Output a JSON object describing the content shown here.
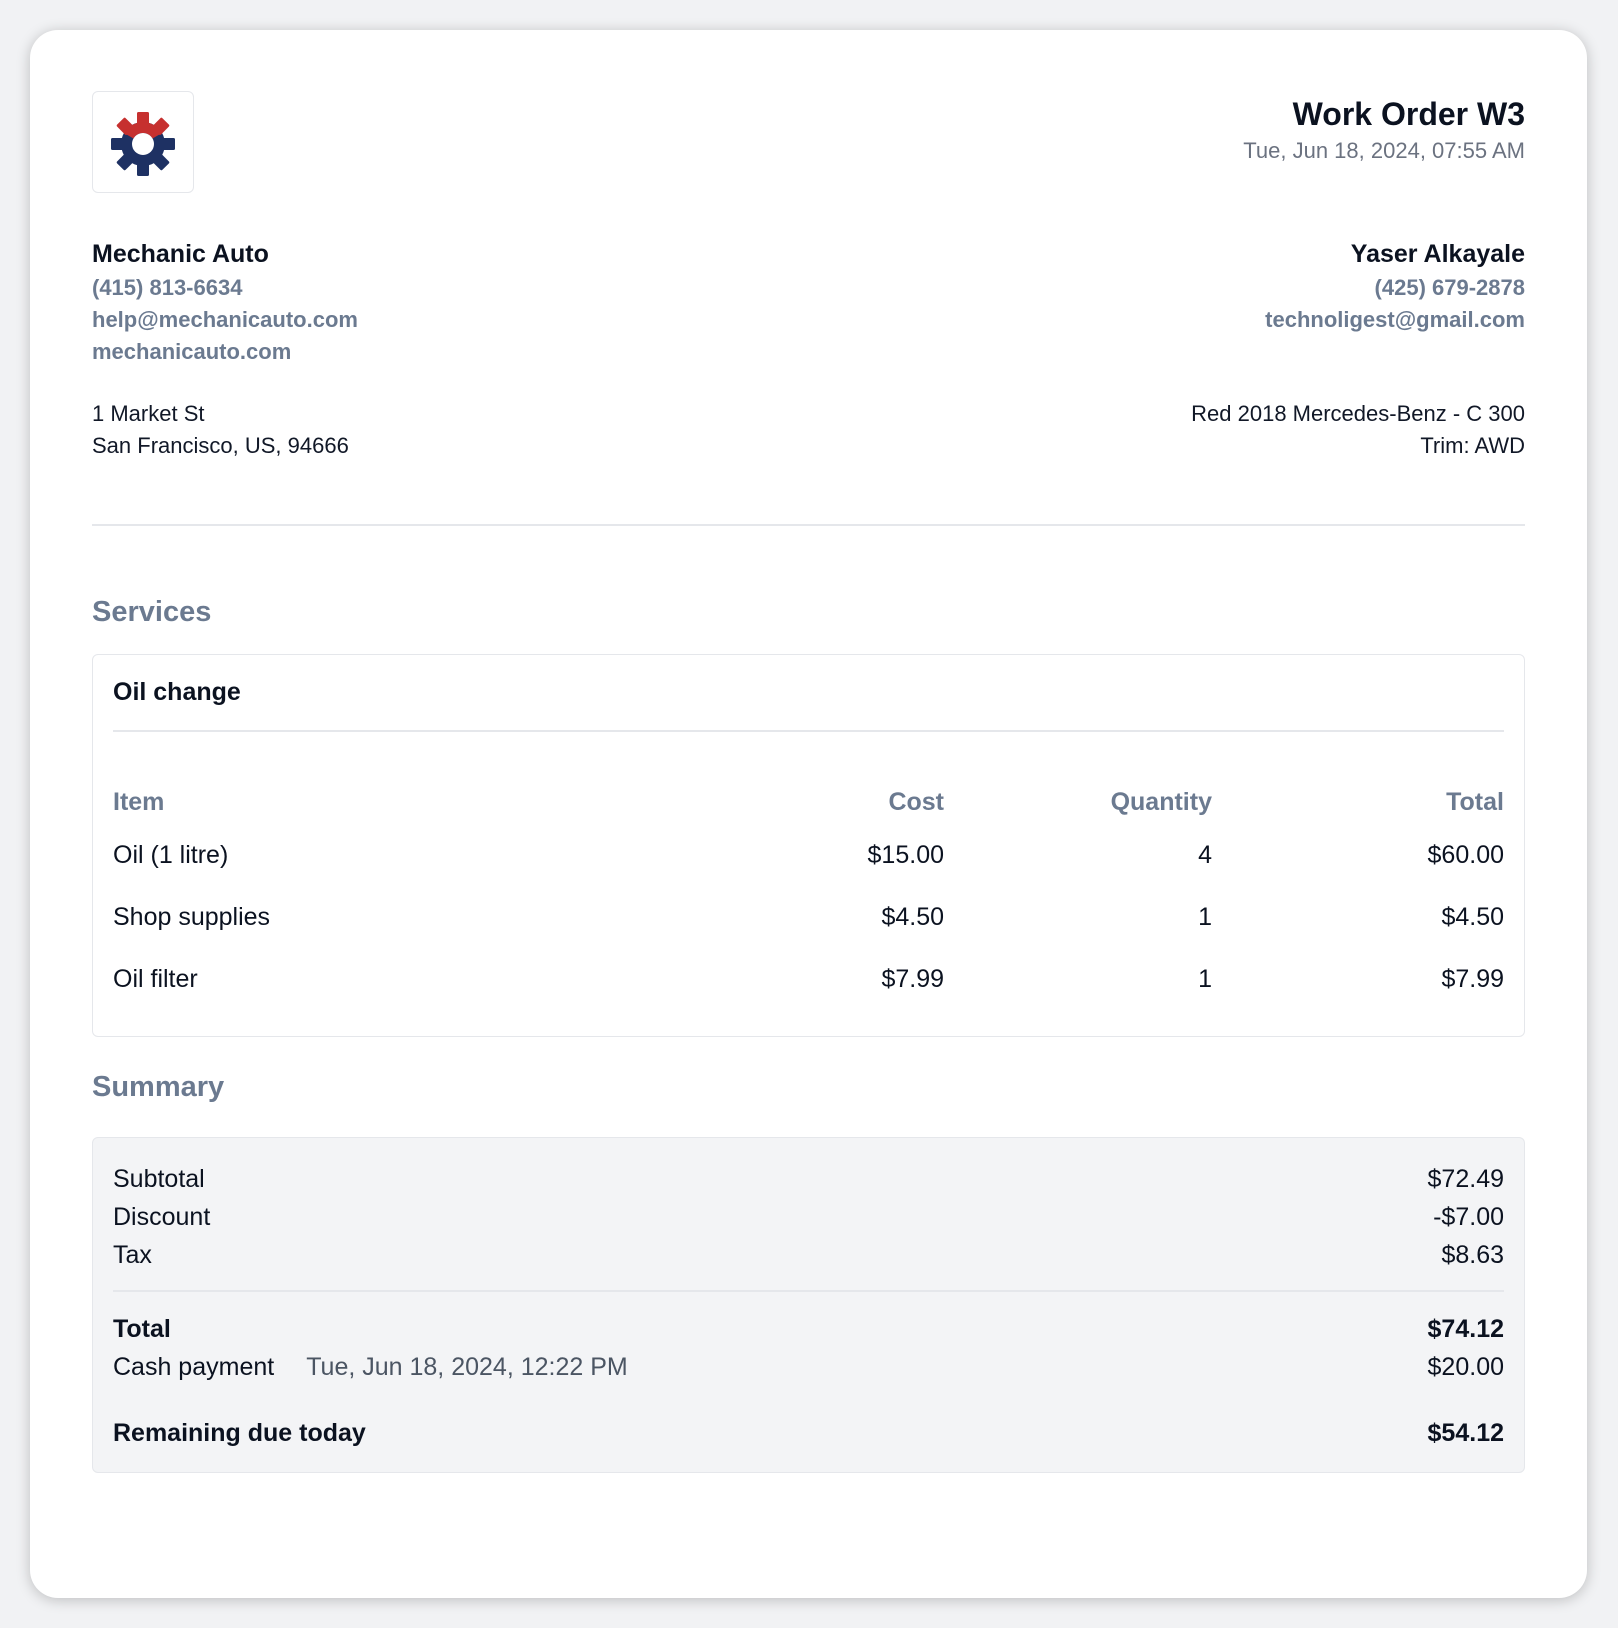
{
  "colors": {
    "logo_red": "#c6302f",
    "logo_navy": "#1e3163",
    "muted_text": "#6b7a90"
  },
  "icons": {
    "logo": "gear-logo-icon"
  },
  "work_order": {
    "title": "Work Order W3",
    "date": "Tue, Jun 18, 2024, 07:55 AM"
  },
  "shop": {
    "name": "Mechanic Auto",
    "phone": "(415) 813-6634",
    "email": "help@mechanicauto.com",
    "website": "mechanicauto.com",
    "address_line1": "1 Market St",
    "address_line2": "San Francisco, US, 94666"
  },
  "customer": {
    "name": "Yaser Alkayale",
    "phone": "(425) 679-2878",
    "email": "technoligest@gmail.com",
    "vehicle": "Red 2018 Mercedes-Benz - C 300",
    "trim": "Trim: AWD"
  },
  "services": {
    "title": "Services",
    "items": [
      {
        "name": "Oil change",
        "headers": {
          "item": "Item",
          "cost": "Cost",
          "quantity": "Quantity",
          "total": "Total"
        },
        "rows": [
          {
            "item": "Oil (1 litre)",
            "cost": "$15.00",
            "quantity": "4",
            "total": "$60.00"
          },
          {
            "item": "Shop supplies",
            "cost": "$4.50",
            "quantity": "1",
            "total": "$4.50"
          },
          {
            "item": "Oil filter",
            "cost": "$7.99",
            "quantity": "1",
            "total": "$7.99"
          }
        ]
      }
    ]
  },
  "summary": {
    "title": "Summary",
    "subtotal_label": "Subtotal",
    "subtotal_value": "$72.49",
    "discount_label": "Discount",
    "discount_value": "-$7.00",
    "tax_label": "Tax",
    "tax_value": "$8.63",
    "total_label": "Total",
    "total_value": "$74.12",
    "payment_label": "Cash payment",
    "payment_date": "Tue, Jun 18, 2024, 12:22 PM",
    "payment_value": "$20.00",
    "remaining_label": "Remaining due today",
    "remaining_value": "$54.12"
  }
}
